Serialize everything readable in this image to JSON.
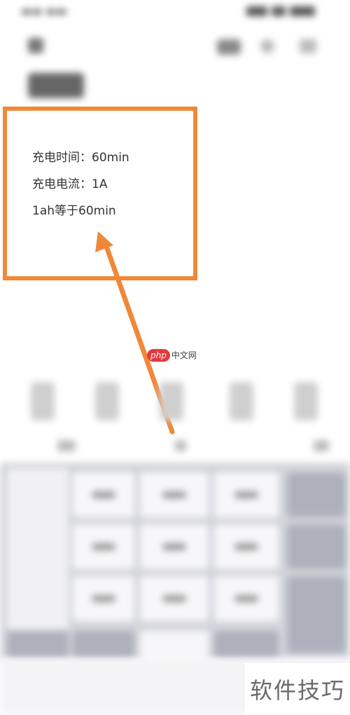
{
  "note": {
    "line1": "充电时间：60min",
    "line2": "充电电流：1A",
    "line3": "1ah等于60min"
  },
  "watermark": {
    "php_label": "php",
    "site_label": "中文网"
  },
  "footer": {
    "label": "软件技巧"
  },
  "colors": {
    "highlight": "#f0883a",
    "keyboard_bg": "#d3d5dc",
    "watermark_red": "#e4393c"
  }
}
